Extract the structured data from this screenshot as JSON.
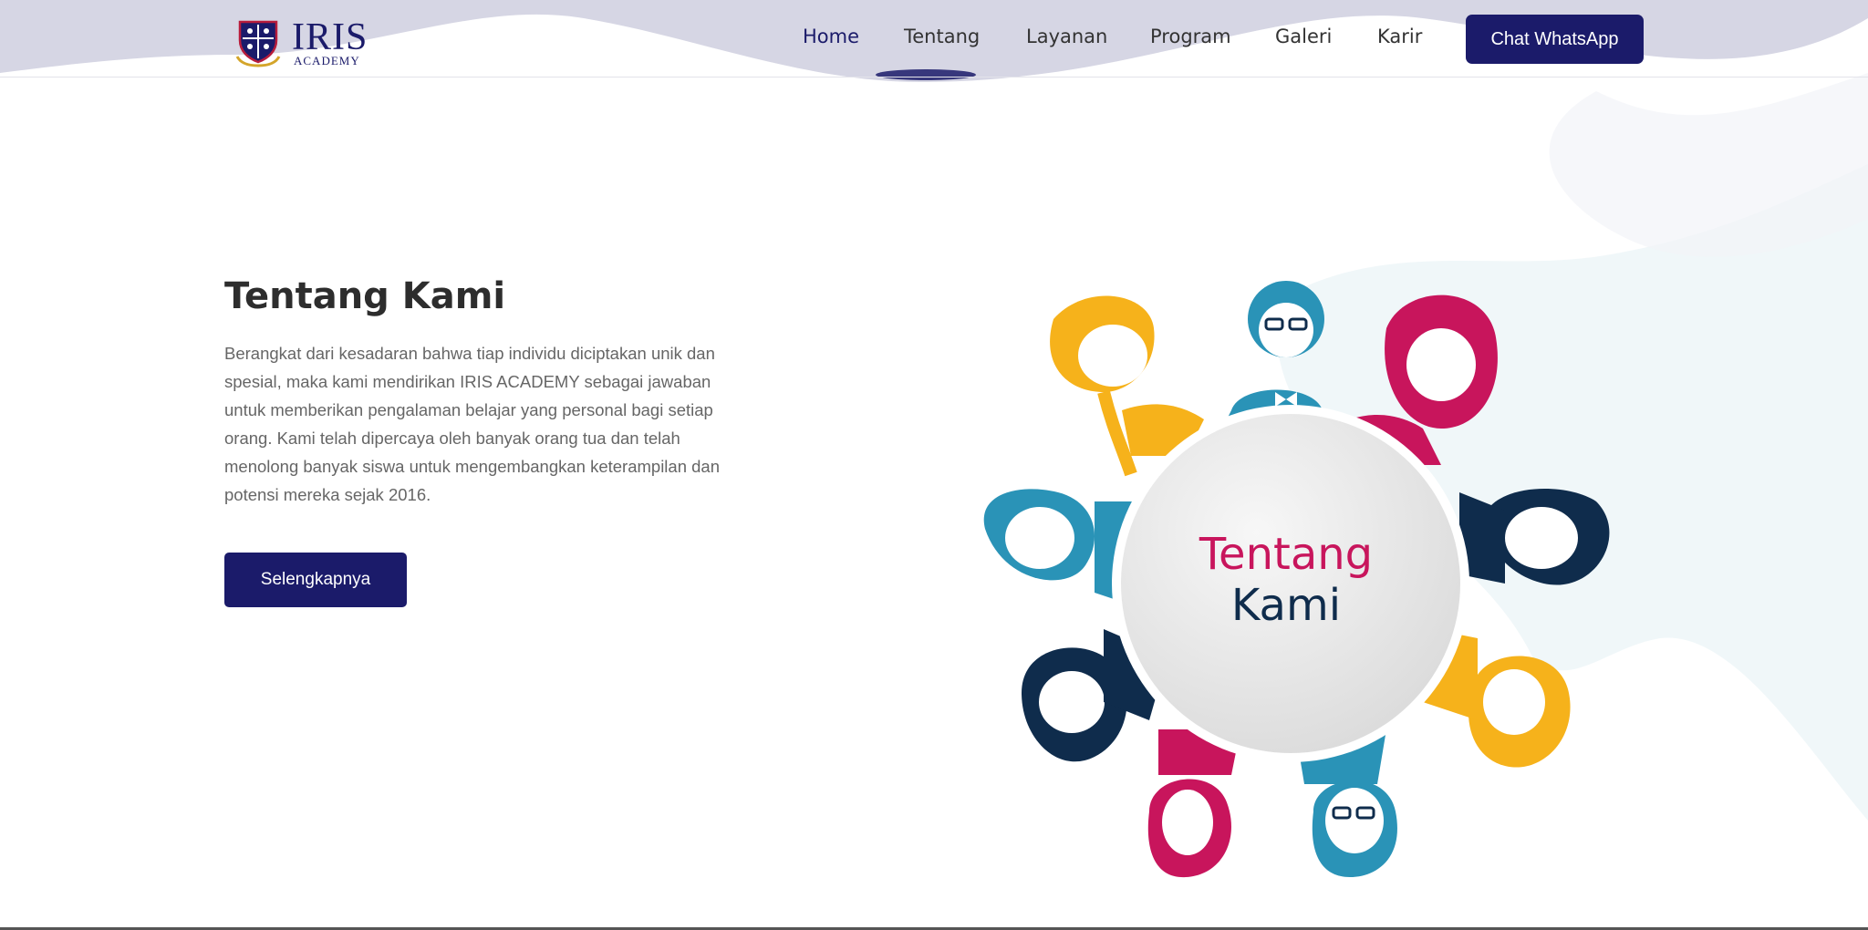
{
  "header": {
    "logo": {
      "name": "IRIS",
      "sub": "ACADEMY"
    },
    "nav": [
      {
        "label": "Home",
        "active": true
      },
      {
        "label": "Tentang",
        "active": false
      },
      {
        "label": "Layanan",
        "active": false
      },
      {
        "label": "Program",
        "active": false
      },
      {
        "label": "Galeri",
        "active": false
      },
      {
        "label": "Karir",
        "active": false
      }
    ],
    "cta_label": "Chat WhatsApp"
  },
  "about": {
    "title": "Tentang Kami",
    "description": "Berangkat dari kesadaran bahwa tiap individu diciptakan unik dan spesial, maka kami mendirikan IRIS ACADEMY sebagai jawaban untuk memberikan pengalaman belajar yang personal bagi setiap orang. Kami telah dipercaya oleh banyak orang tua dan telah menolong banyak siswa untuk mengembangkan keterampilan dan potensi mereka sejak 2016.",
    "button_label": "Selengkapnya"
  },
  "illustration": {
    "title_line1": "Tentang",
    "title_line2": "Kami"
  },
  "colors": {
    "brand": "#1b1b6a",
    "pink": "#c8155c",
    "teal": "#2a93b7",
    "yellow": "#f6b21b",
    "navy": "#0f2c4c"
  }
}
